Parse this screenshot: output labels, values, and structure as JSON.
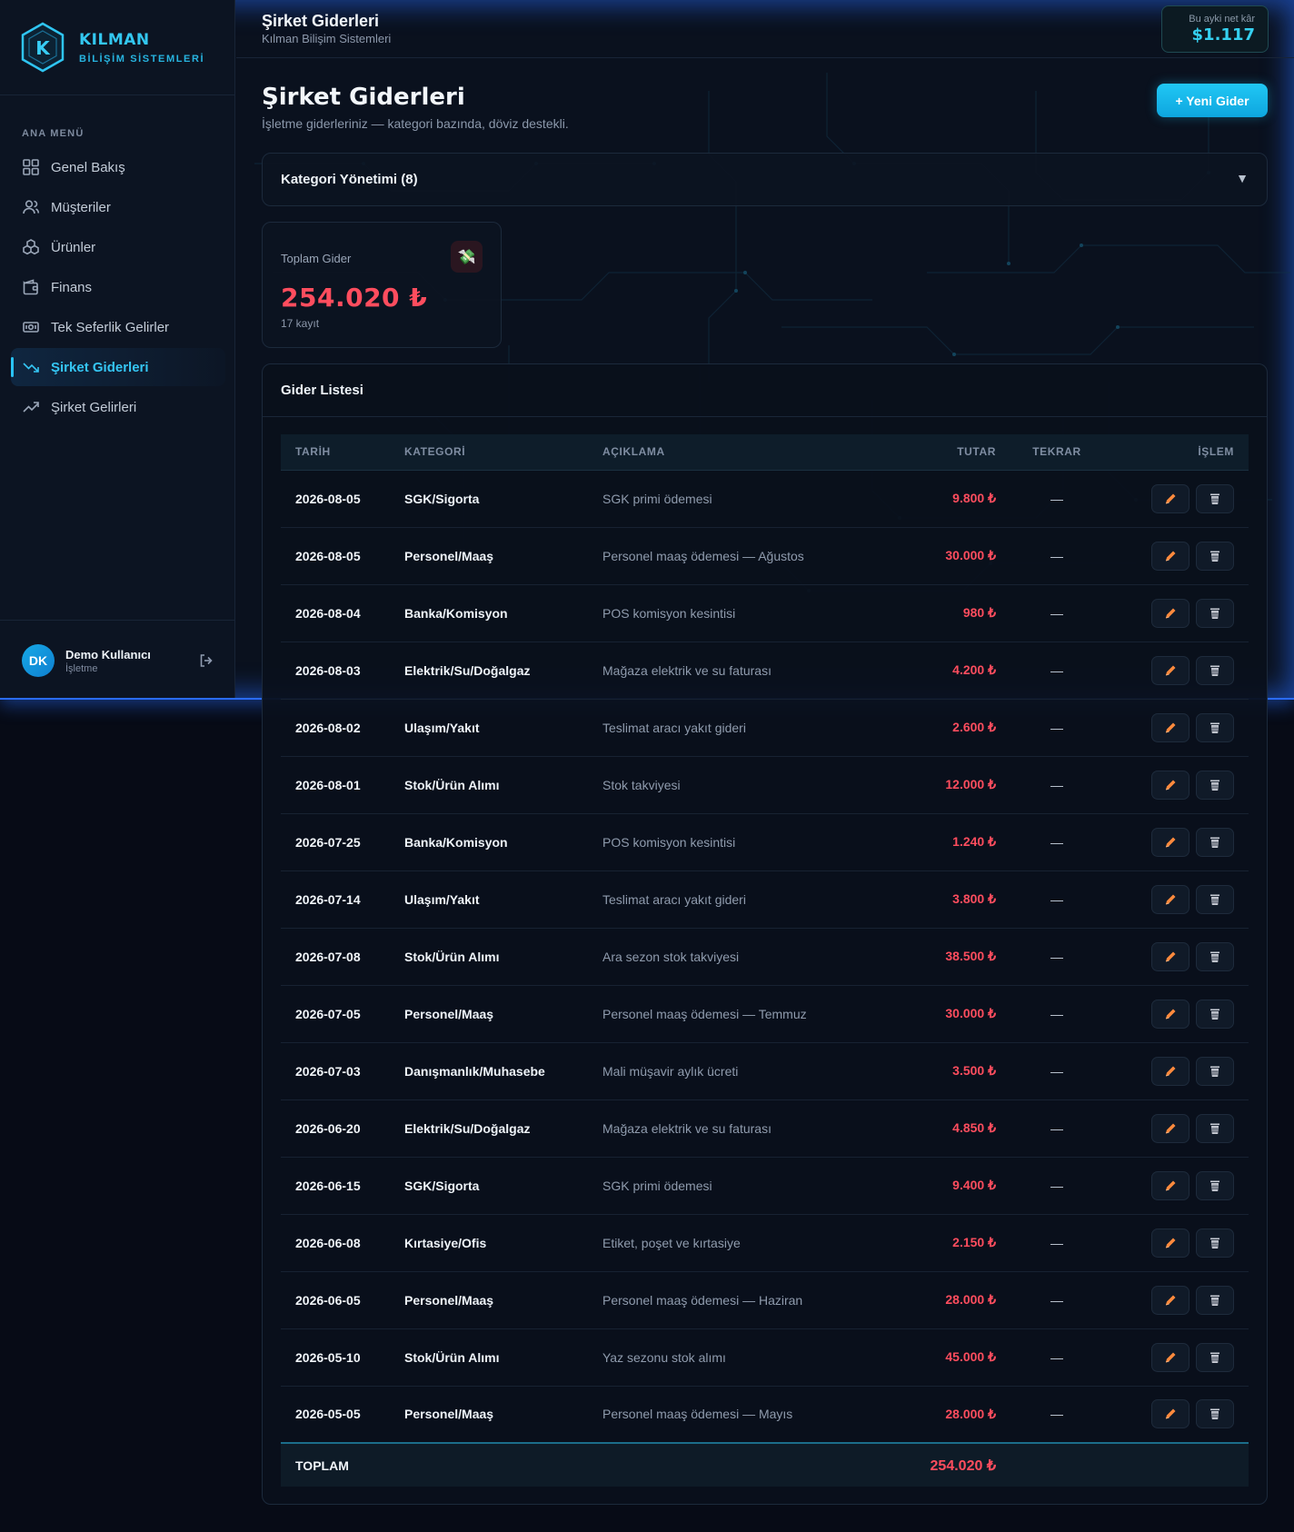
{
  "brand": {
    "name": "KILMAN",
    "subtitle": "BİLİŞİM SİSTEMLERİ",
    "logo_letter": "K"
  },
  "sidebar": {
    "section_title": "ANA MENÜ",
    "items": [
      {
        "label": "Genel Bakış",
        "icon": "grid-icon"
      },
      {
        "label": "Müşteriler",
        "icon": "users-icon"
      },
      {
        "label": "Ürünler",
        "icon": "boxes-icon"
      },
      {
        "label": "Finans",
        "icon": "wallet-icon"
      },
      {
        "label": "Tek Seferlik Gelirler",
        "icon": "cash-icon"
      },
      {
        "label": "Şirket Giderleri",
        "icon": "trend-down-icon",
        "active": true
      },
      {
        "label": "Şirket Gelirleri",
        "icon": "trend-up-icon"
      }
    ],
    "user": {
      "initials": "DK",
      "name": "Demo Kullanıcı",
      "role": "İşletme"
    }
  },
  "topbar": {
    "title": "Şirket Giderleri",
    "subtitle": "Kılman Bilişim Sistemleri",
    "profit_label": "Bu ayki net kâr",
    "profit_value": "$1.117"
  },
  "page": {
    "title": "Şirket Giderleri",
    "subtitle": "İşletme giderleriniz — kategori bazında, döviz destekli.",
    "new_button": "+ Yeni Gider"
  },
  "category_panel": {
    "title": "Kategori Yönetimi (8)",
    "caret": "▼"
  },
  "stat": {
    "label": "Toplam Gider",
    "icon": "💸",
    "value": "254.020 ₺",
    "count": "17 kayıt"
  },
  "list": {
    "title": "Gider Listesi",
    "columns": {
      "date": "TARİH",
      "category": "KATEGORİ",
      "description": "AÇIKLAMA",
      "amount": "TUTAR",
      "repeat": "TEKRAR",
      "action": "İŞLEM"
    },
    "rows": [
      {
        "date": "2026-08-05",
        "category": "SGK/Sigorta",
        "description": "SGK primi ödemesi",
        "amount": "9.800 ₺",
        "repeat": "—"
      },
      {
        "date": "2026-08-05",
        "category": "Personel/Maaş",
        "description": "Personel maaş ödemesi — Ağustos",
        "amount": "30.000 ₺",
        "repeat": "—"
      },
      {
        "date": "2026-08-04",
        "category": "Banka/Komisyon",
        "description": "POS komisyon kesintisi",
        "amount": "980 ₺",
        "repeat": "—"
      },
      {
        "date": "2026-08-03",
        "category": "Elektrik/Su/Doğalgaz",
        "description": "Mağaza elektrik ve su faturası",
        "amount": "4.200 ₺",
        "repeat": "—"
      },
      {
        "date": "2026-08-02",
        "category": "Ulaşım/Yakıt",
        "description": "Teslimat aracı yakıt gideri",
        "amount": "2.600 ₺",
        "repeat": "—"
      },
      {
        "date": "2026-08-01",
        "category": "Stok/Ürün Alımı",
        "description": "Stok takviyesi",
        "amount": "12.000 ₺",
        "repeat": "—"
      },
      {
        "date": "2026-07-25",
        "category": "Banka/Komisyon",
        "description": "POS komisyon kesintisi",
        "amount": "1.240 ₺",
        "repeat": "—"
      },
      {
        "date": "2026-07-14",
        "category": "Ulaşım/Yakıt",
        "description": "Teslimat aracı yakıt gideri",
        "amount": "3.800 ₺",
        "repeat": "—"
      },
      {
        "date": "2026-07-08",
        "category": "Stok/Ürün Alımı",
        "description": "Ara sezon stok takviyesi",
        "amount": "38.500 ₺",
        "repeat": "—"
      },
      {
        "date": "2026-07-05",
        "category": "Personel/Maaş",
        "description": "Personel maaş ödemesi — Temmuz",
        "amount": "30.000 ₺",
        "repeat": "—"
      },
      {
        "date": "2026-07-03",
        "category": "Danışmanlık/Muhasebe",
        "description": "Mali müşavir aylık ücreti",
        "amount": "3.500 ₺",
        "repeat": "—"
      },
      {
        "date": "2026-06-20",
        "category": "Elektrik/Su/Doğalgaz",
        "description": "Mağaza elektrik ve su faturası",
        "amount": "4.850 ₺",
        "repeat": "—"
      },
      {
        "date": "2026-06-15",
        "category": "SGK/Sigorta",
        "description": "SGK primi ödemesi",
        "amount": "9.400 ₺",
        "repeat": "—"
      },
      {
        "date": "2026-06-08",
        "category": "Kırtasiye/Ofis",
        "description": "Etiket, poşet ve kırtasiye",
        "amount": "2.150 ₺",
        "repeat": "—"
      },
      {
        "date": "2026-06-05",
        "category": "Personel/Maaş",
        "description": "Personel maaş ödemesi — Haziran",
        "amount": "28.000 ₺",
        "repeat": "—"
      },
      {
        "date": "2026-05-10",
        "category": "Stok/Ürün Alımı",
        "description": "Yaz sezonu stok alımı",
        "amount": "45.000 ₺",
        "repeat": "—"
      },
      {
        "date": "2026-05-05",
        "category": "Personel/Maaş",
        "description": "Personel maaş ödemesi — Mayıs",
        "amount": "28.000 ₺",
        "repeat": "—"
      }
    ],
    "total_label": "TOPLAM",
    "total_value": "254.020 ₺"
  },
  "colors": {
    "accent": "#29c3f5",
    "expense": "#ff4d5e",
    "edit": "#ff8a3d",
    "background": "#070b16"
  }
}
